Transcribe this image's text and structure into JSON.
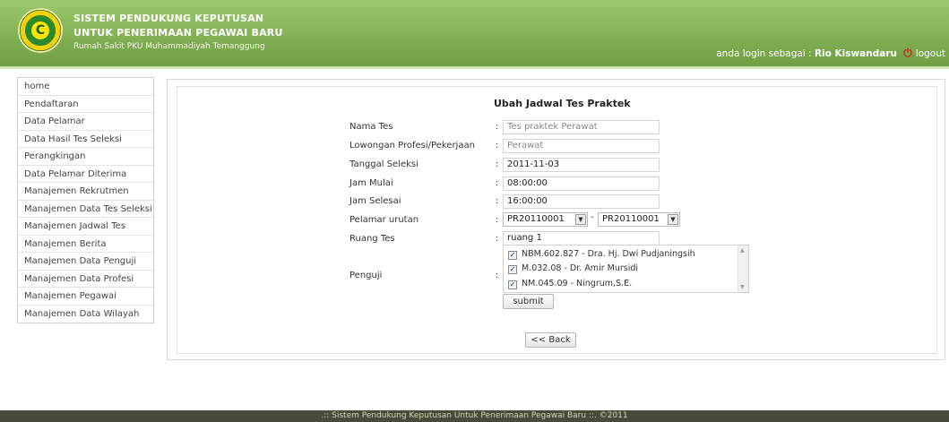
{
  "header": {
    "logo_text": "C",
    "title_line1": "SISTEM PENDUKUNG KEPUTUSAN",
    "title_line2": "UNTUK PENERIMAAN PEGAWAI BARU",
    "subtitle": "Rumah Sakit PKU Muhammadiyah Temanggung",
    "login_prefix": "anda login sebagai : ",
    "login_user": "Rio Kiswandaru",
    "logout_label": "logout"
  },
  "sidebar": {
    "items": [
      "home",
      "Pendaftaran",
      "Data Pelamar",
      "Data Hasil Tes Seleksi",
      "Perangkingan",
      "Data Pelamar Diterima",
      "Manajemen Rekrutmen",
      "Manajemen Data Tes Seleksi",
      "Manajemen Jadwal Tes",
      "Manajemen Berita",
      "Manajemen Data Penguji",
      "Manajemen Data Profesi",
      "Manajemen Pegawai",
      "Manajemen Data Wilayah"
    ]
  },
  "form": {
    "heading": "Ubah Jadwal Tes Praktek",
    "colon": ":",
    "labels": {
      "nama_tes": "Nama Tes",
      "lowongan": "Lowongan Profesi/Pekerjaan",
      "tanggal": "Tanggal Seleksi",
      "jam_mulai": "Jam Mulai",
      "jam_selesai": "Jam Selesai",
      "pelamar_urutan": "Pelamar urutan",
      "ruang": "Ruang Tes",
      "penguji": "Penguji"
    },
    "values": {
      "nama_tes": "Tes praktek Perawat",
      "lowongan": "Perawat",
      "tanggal": "2011-11-03",
      "jam_mulai": "08:00:00",
      "jam_selesai": "16:00:00",
      "pelamar_from": "PR20110001",
      "pelamar_to": "PR20110001",
      "ruang": "ruang 1"
    },
    "range_separator": "-",
    "penguji_options": [
      "NBM.602.827 - Dra. Hj. Dwi Pudjaningsih",
      "M.032.08 - Dr. Amir Mursidi",
      "NM.045.09 - Ningrum,S.E."
    ],
    "submit_label": "submit",
    "back_label": "<< Back"
  },
  "footer": {
    "text": ".:: Sistem Pendukung Keputusan Untuk Penerimaan Pegawai Baru ::. ©2011"
  }
}
